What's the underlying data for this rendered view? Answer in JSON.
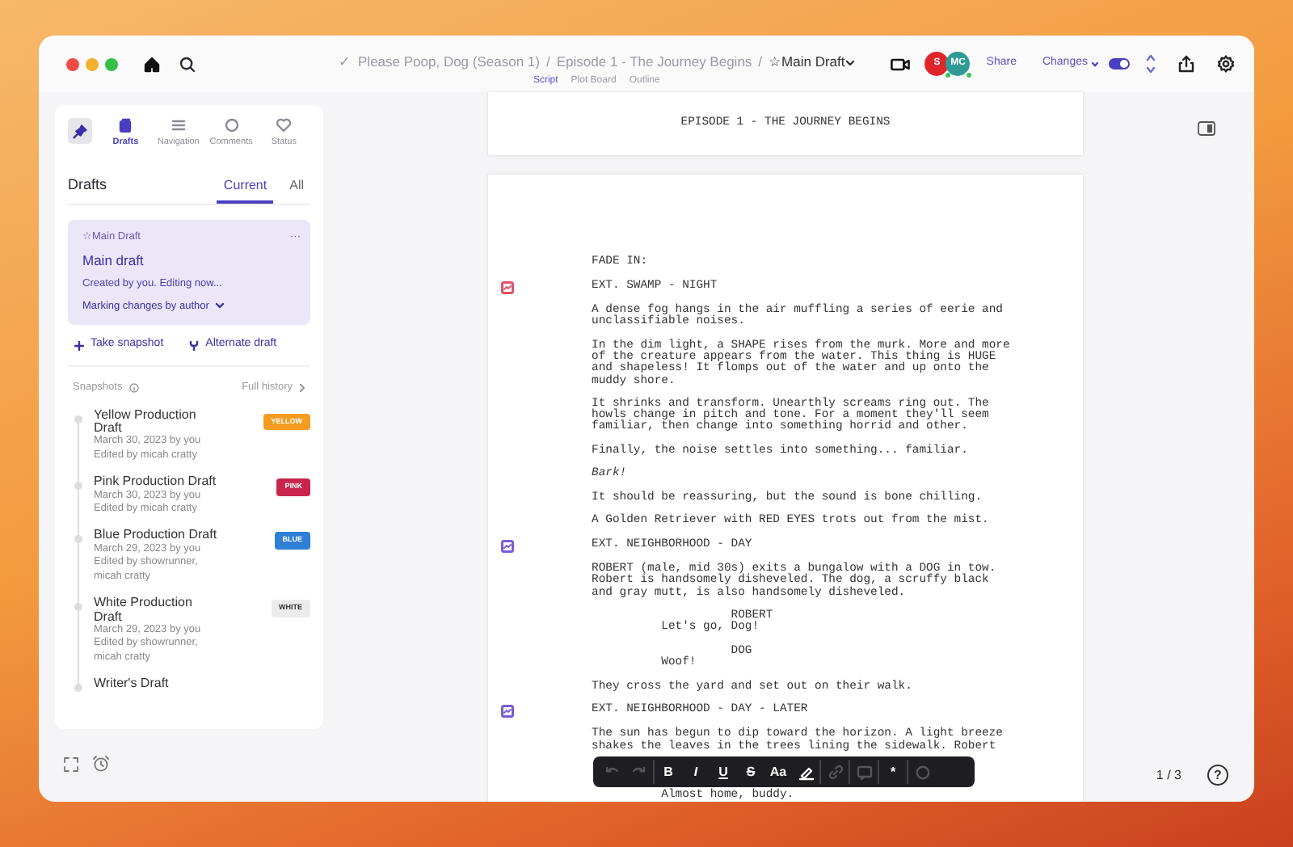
{
  "breadcrumb": {
    "status": "✓",
    "crumbs": [
      "Please Poop, Dog (Season 1)",
      "/",
      "Episode 1 - The Journey Begins",
      "/"
    ],
    "current": "☆Main Draft"
  },
  "view_tabs": [
    {
      "label": "Script",
      "selected": true
    },
    {
      "label": "Plot Board",
      "selected": false
    },
    {
      "label": "Outline",
      "selected": false
    }
  ],
  "avatars": [
    {
      "initials": "S",
      "color": "#e0262b",
      "online": true
    },
    {
      "initials": "MC",
      "color": "#2f9a96",
      "online": true
    }
  ],
  "share": "Share",
  "changes": {
    "label": "Changes",
    "on": true
  },
  "sidebar": {
    "tabs": [
      {
        "label": "Drafts",
        "kind": "drafts",
        "selected": true
      },
      {
        "label": "Navigation",
        "kind": "navigation",
        "selected": false
      },
      {
        "label": "Comments",
        "kind": "comments",
        "selected": false
      },
      {
        "label": "Status",
        "kind": "status",
        "selected": false
      }
    ],
    "title": "Drafts",
    "filter_tabs": [
      {
        "label": "Current",
        "selected": true
      },
      {
        "label": "All",
        "selected": false
      }
    ],
    "current_draft": {
      "tag": "☆Main Draft",
      "menu": "···",
      "name": "Main draft",
      "status": "Created by you. Editing now...",
      "mode": "Marking changes by author"
    },
    "actions": [
      {
        "kind": "snapshot",
        "label": "Take snapshot"
      },
      {
        "kind": "alternate",
        "label": "Alternate draft"
      }
    ],
    "snapshots_label": "Snapshots",
    "history_link": "Full history",
    "snapshots": [
      {
        "title": "Yellow Production Draft",
        "date": "March 30, 2023 by you",
        "edited": "Edited by micah cratty",
        "badge": "YELLOW",
        "color": "#f39c1f"
      },
      {
        "title": "Pink Production Draft",
        "date": "March 30, 2023 by you",
        "edited": "Edited by micah cratty",
        "badge": "PINK",
        "color": "#c9254c"
      },
      {
        "title": "Blue Production Draft",
        "date": "March 29, 2023 by you",
        "edited": "Edited by showrunner, micah cratty",
        "badge": "BLUE",
        "color": "#2f7fd6"
      },
      {
        "title": "White Production Draft",
        "date": "March 29, 2023 by you",
        "edited": "Edited by showrunner, micah cratty",
        "badge": "WHITE",
        "color": "#ececec"
      },
      {
        "title": "Writer's Draft"
      }
    ]
  },
  "script": {
    "header": "EPISODE 1 - THE JOURNEY BEGINS",
    "page_indicator": "1 / 3",
    "elements": [
      {
        "kind": "transition",
        "text": "FADE IN:"
      },
      {
        "kind": "scene",
        "text": "EXT. SWAMP - NIGHT",
        "color": "#e0526a"
      },
      {
        "kind": "action",
        "text": "A dense fog hangs in the air muffling a series of eerie and unclassifiable noises."
      },
      {
        "kind": "action",
        "text": "In the dim light, a SHAPE rises from the murk. More and more of the creature appears from the water. This thing is HUGE and shapeless! It flomps out of the water and up onto the muddy shore."
      },
      {
        "kind": "action",
        "text": "It shrinks and transform. Unearthly screams ring out. The howls change in pitch and tone. For a moment they'll seem familiar, then change into something horrid and other."
      },
      {
        "kind": "action",
        "text": "Finally, the noise settles into something... familiar."
      },
      {
        "kind": "emphasis",
        "text": "Bark!"
      },
      {
        "kind": "action",
        "text": "It should be reassuring, but the sound is bone chilling."
      },
      {
        "kind": "action",
        "text": "A Golden Retriever with RED EYES trots out from the mist."
      },
      {
        "kind": "scene",
        "text": "EXT. NEIGHBORHOOD - DAY",
        "color": "#7a5bd6"
      },
      {
        "kind": "action",
        "text": "ROBERT (male, mid 30s) exits a bungalow with a DOG in tow. Robert is handsomely disheveled. The dog, a scruffy black and gray mutt, is also handsomely disheveled."
      },
      {
        "kind": "character",
        "text": "ROBERT"
      },
      {
        "kind": "dialogue",
        "text": "Let's go, Dog!"
      },
      {
        "kind": "character",
        "text": "DOG"
      },
      {
        "kind": "dialogue",
        "text": "Woof!"
      },
      {
        "kind": "action",
        "text": "They cross the yard and set out on their walk."
      },
      {
        "kind": "scene",
        "text": "EXT. NEIGHBORHOOD - DAY - LATER",
        "color": "#7a5bd6"
      },
      {
        "kind": "action",
        "text": "The sun has begun to dip toward the horizon. A light breeze shakes the leaves in the trees lining the sidewalk. Robert"
      },
      {
        "kind": "dialogue",
        "text": "Almost home, buddy."
      }
    ]
  },
  "format_bar": [
    {
      "kind": "undo",
      "disabled": true
    },
    {
      "kind": "redo",
      "disabled": true
    },
    {
      "kind": "bold",
      "label": "B",
      "disabled": false
    },
    {
      "kind": "italic",
      "label": "I",
      "disabled": false
    },
    {
      "kind": "underline",
      "label": "U",
      "disabled": false
    },
    {
      "kind": "strike",
      "label": "S",
      "disabled": false
    },
    {
      "kind": "case",
      "label": "Aa",
      "disabled": false
    },
    {
      "kind": "highlight",
      "disabled": false
    },
    {
      "kind": "link",
      "disabled": true
    },
    {
      "kind": "note",
      "disabled": true
    },
    {
      "kind": "asterisk",
      "label": "*",
      "disabled": false
    },
    {
      "kind": "comment",
      "disabled": true
    }
  ],
  "help": "?"
}
